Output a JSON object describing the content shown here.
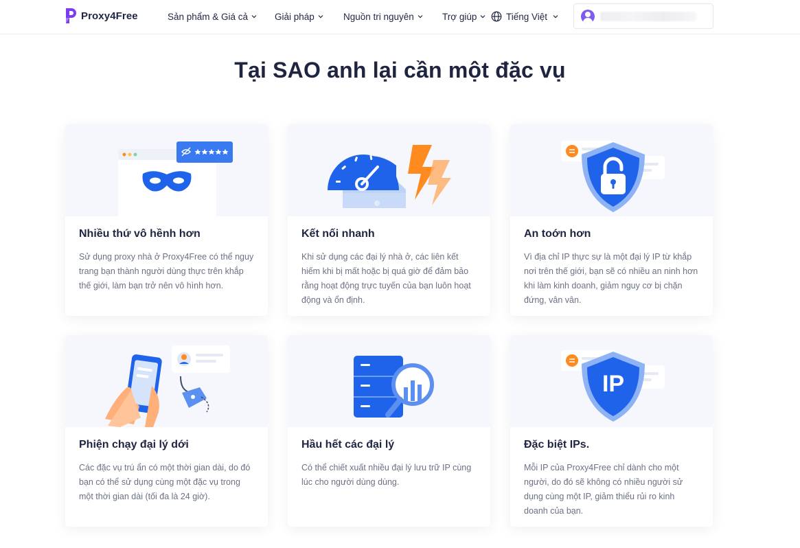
{
  "header": {
    "logo_text": "Proxy4Free",
    "nav": [
      {
        "label": "Sản phẩm & Giá cả"
      },
      {
        "label": "Giải pháp"
      },
      {
        "label": "Nguồn tri nguyên"
      },
      {
        "label": "Trợ giúp"
      }
    ],
    "language": "Tiếng Việt"
  },
  "main": {
    "title": "Tại SAO anh lại cần một đặc vụ",
    "cards": [
      {
        "title": "Nhiều thứ vô hềnh hơn",
        "desc": "Sử dụng proxy nhà ở Proxy4Free có thể nguy trang bạn thành người dùng thực trên khắp thế giới, làm bạn trở nên vô hình hơn."
      },
      {
        "title": "Kết nối nhanh",
        "desc": "Khi sử dụng các đại lý nhà ở, các liên kết hiếm khi bị mất hoặc bị quá giờ để đảm bảo rằng hoạt động trực tuyến của bạn luôn hoạt động và ổn định."
      },
      {
        "title": "An toớn hơn",
        "desc": "Vì địa chỉ IP thực sự là một đại lý IP từ khắp nơi trên thế giới, bạn sẽ có nhiều an ninh hơn khi làm kinh doanh, giảm nguy cơ bị chặn đứng, vân vân."
      },
      {
        "title": "Phiện chạy đại lý dới",
        "desc": "Các đặc vụ trú ẩn có một thời gian dài, do đó bạn có thể sử dụng cùng một đặc vụ trong một thời gian dài (tối đa là 24 giờ)."
      },
      {
        "title": "Hầu hết các đại lý",
        "desc": "Có thể chiết xuất nhiều đại lý lưu trữ IP cùng lúc cho người dùng dùng."
      },
      {
        "title": "Đặc biệt IPs.",
        "desc": "Mỗi IP của Proxy4Free chỉ dành cho một người, do đó sẽ không có nhiều người sử dụng cùng một IP, giảm thiểu rủi ro kinh doanh của bạn.",
        "badge": "IP"
      }
    ]
  },
  "colors": {
    "brand_purple": "#7b3cf2",
    "accent_blue": "#2d6bef",
    "accent_orange": "#ff8a1f",
    "title_text": "#1f2540",
    "body_text": "#6b7184"
  }
}
